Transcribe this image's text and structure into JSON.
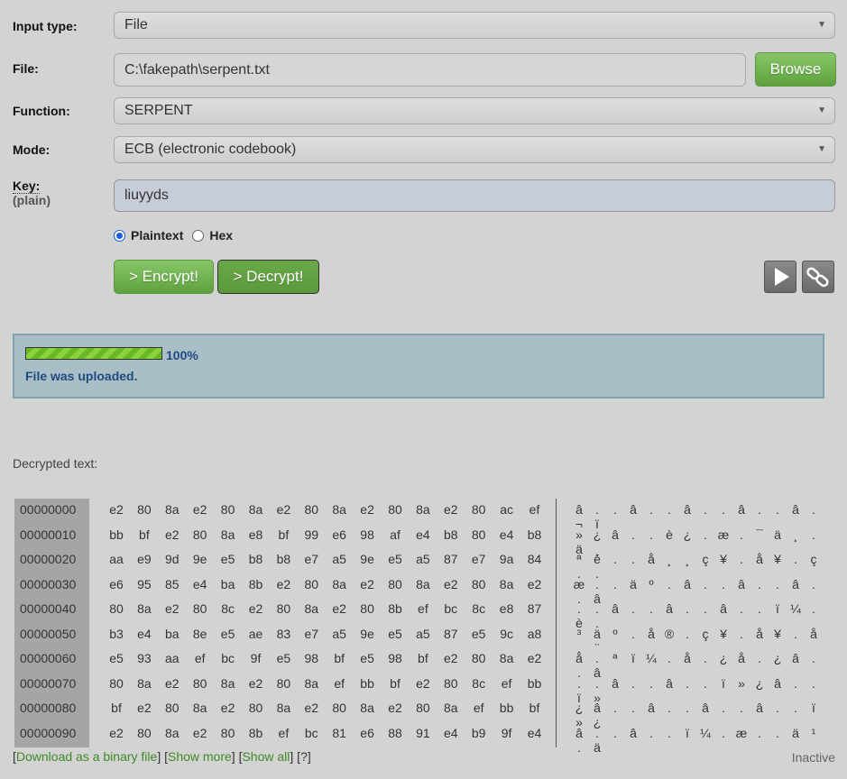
{
  "form": {
    "input_type": {
      "label": "Input type:",
      "value": "File"
    },
    "file": {
      "label": "File:",
      "value": "C:\\fakepath\\serpent.txt",
      "browse_label": "Browse"
    },
    "function": {
      "label": "Function:",
      "value": "SERPENT"
    },
    "mode": {
      "label": "Mode:",
      "value": "ECB (electronic codebook)"
    },
    "key": {
      "label": "Key:",
      "sublabel": "(plain)",
      "value": "liuyyds"
    },
    "radios": {
      "plaintext_label": "Plaintext",
      "hex_label": "Hex",
      "selected": "Plaintext"
    },
    "encrypt_label": "> Encrypt!",
    "decrypt_label": "> Decrypt!"
  },
  "status": {
    "progress": 100,
    "progress_text": "100%",
    "message": "File was uploaded."
  },
  "output": {
    "label": "Decrypted text:",
    "rows": [
      {
        "offset": "00000000",
        "hex": [
          "e2",
          "80",
          "8a",
          "e2",
          "80",
          "8a",
          "e2",
          "80",
          "8a",
          "e2",
          "80",
          "8a",
          "e2",
          "80",
          "ac",
          "ef"
        ],
        "ascii": "â..â..â..â..â.¬ï"
      },
      {
        "offset": "00000010",
        "hex": [
          "bb",
          "bf",
          "e2",
          "80",
          "8a",
          "e8",
          "bf",
          "99",
          "e6",
          "98",
          "af",
          "e4",
          "b8",
          "80",
          "e4",
          "b8"
        ],
        "ascii": "»¿â..è¿.æ.¯ä¸.ä¸"
      },
      {
        "offset": "00000020",
        "hex": [
          "aa",
          "e9",
          "9d",
          "9e",
          "e5",
          "b8",
          "b8",
          "e7",
          "a5",
          "9e",
          "e5",
          "a5",
          "87",
          "e7",
          "9a",
          "84"
        ],
        "ascii": "ªé..å¸¸ç¥.å¥.ç.."
      },
      {
        "offset": "00000030",
        "hex": [
          "e6",
          "95",
          "85",
          "e4",
          "ba",
          "8b",
          "e2",
          "80",
          "8a",
          "e2",
          "80",
          "8a",
          "e2",
          "80",
          "8a",
          "e2"
        ],
        "ascii": "æ..äº.â..â..â..â"
      },
      {
        "offset": "00000040",
        "hex": [
          "80",
          "8a",
          "e2",
          "80",
          "8c",
          "e2",
          "80",
          "8a",
          "e2",
          "80",
          "8b",
          "ef",
          "bc",
          "8c",
          "e8",
          "87"
        ],
        "ascii": "..â..â..â..ï¼.è."
      },
      {
        "offset": "00000050",
        "hex": [
          "b3",
          "e4",
          "ba",
          "8e",
          "e5",
          "ae",
          "83",
          "e7",
          "a5",
          "9e",
          "e5",
          "a5",
          "87",
          "e5",
          "9c",
          "a8"
        ],
        "ascii": "³äº.å®.ç¥.å¥.å.¨"
      },
      {
        "offset": "00000060",
        "hex": [
          "e5",
          "93",
          "aa",
          "ef",
          "bc",
          "9f",
          "e5",
          "98",
          "bf",
          "e5",
          "98",
          "bf",
          "e2",
          "80",
          "8a",
          "e2"
        ],
        "ascii": "å.ªï¼.å.¿å.¿â..â"
      },
      {
        "offset": "00000070",
        "hex": [
          "80",
          "8a",
          "e2",
          "80",
          "8a",
          "e2",
          "80",
          "8a",
          "ef",
          "bb",
          "bf",
          "e2",
          "80",
          "8c",
          "ef",
          "bb"
        ],
        "ascii": "..â..â..ï»¿â..ï»"
      },
      {
        "offset": "00000080",
        "hex": [
          "bf",
          "e2",
          "80",
          "8a",
          "e2",
          "80",
          "8a",
          "e2",
          "80",
          "8a",
          "e2",
          "80",
          "8a",
          "ef",
          "bb",
          "bf"
        ],
        "ascii": "¿â..â..â..â..ï»¿"
      },
      {
        "offset": "00000090",
        "hex": [
          "e2",
          "80",
          "8a",
          "e2",
          "80",
          "8b",
          "ef",
          "bc",
          "81",
          "e6",
          "88",
          "91",
          "e4",
          "b9",
          "9f",
          "e4"
        ],
        "ascii": "â..â..ï¼.æ..ä¹.ä"
      }
    ],
    "links": {
      "download": "Download as a binary file",
      "show_more": "Show more",
      "show_all": "Show all",
      "help": "?"
    },
    "state": "Inactive"
  }
}
